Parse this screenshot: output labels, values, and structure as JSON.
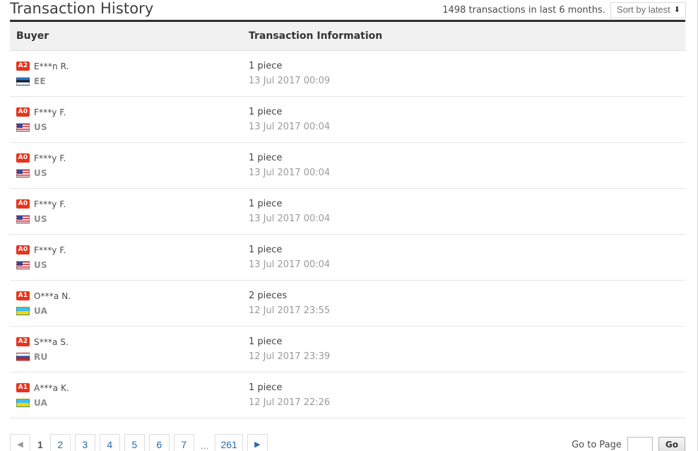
{
  "header": {
    "title": "Transaction History",
    "transaction_count_text": "1498 transactions in last 6 months.",
    "sort_label": "Sort by latest",
    "sort_arrow_glyph": "⬇"
  },
  "table": {
    "columns": {
      "buyer": "Buyer",
      "info": "Transaction Information"
    },
    "rows": [
      {
        "rank": "A2",
        "name": "E***n R.",
        "country": "EE",
        "flag": "ee",
        "quantity": "1 piece",
        "date": "13 Jul 2017 00:09"
      },
      {
        "rank": "A0",
        "name": "F***y F.",
        "country": "US",
        "flag": "us",
        "quantity": "1 piece",
        "date": "13 Jul 2017 00:04"
      },
      {
        "rank": "A0",
        "name": "F***y F.",
        "country": "US",
        "flag": "us",
        "quantity": "1 piece",
        "date": "13 Jul 2017 00:04"
      },
      {
        "rank": "A0",
        "name": "F***y F.",
        "country": "US",
        "flag": "us",
        "quantity": "1 piece",
        "date": "13 Jul 2017 00:04"
      },
      {
        "rank": "A0",
        "name": "F***y F.",
        "country": "US",
        "flag": "us",
        "quantity": "1 piece",
        "date": "13 Jul 2017 00:04"
      },
      {
        "rank": "A1",
        "name": "O***a N.",
        "country": "UA",
        "flag": "ua",
        "quantity": "2 pieces",
        "date": "12 Jul 2017 23:55"
      },
      {
        "rank": "A2",
        "name": "S***a S.",
        "country": "RU",
        "flag": "ru",
        "quantity": "1 piece",
        "date": "12 Jul 2017 23:39"
      },
      {
        "rank": "A1",
        "name": "A***a K.",
        "country": "UA",
        "flag": "ua",
        "quantity": "1 piece",
        "date": "12 Jul 2017 22:26"
      }
    ]
  },
  "pagination": {
    "prev_glyph": "◀",
    "next_glyph": "▶",
    "current_page": "1",
    "pages": [
      "2",
      "3",
      "4",
      "5",
      "6",
      "7"
    ],
    "ellipsis": "...",
    "last_page": "261",
    "goto_label": "Go to Page",
    "goto_value": "",
    "goto_placeholder": "",
    "go_button": "Go"
  },
  "colors": {
    "rank_badge": "#e8331c",
    "link": "#2a6ba8",
    "header_rule": "#2f2f2f"
  }
}
